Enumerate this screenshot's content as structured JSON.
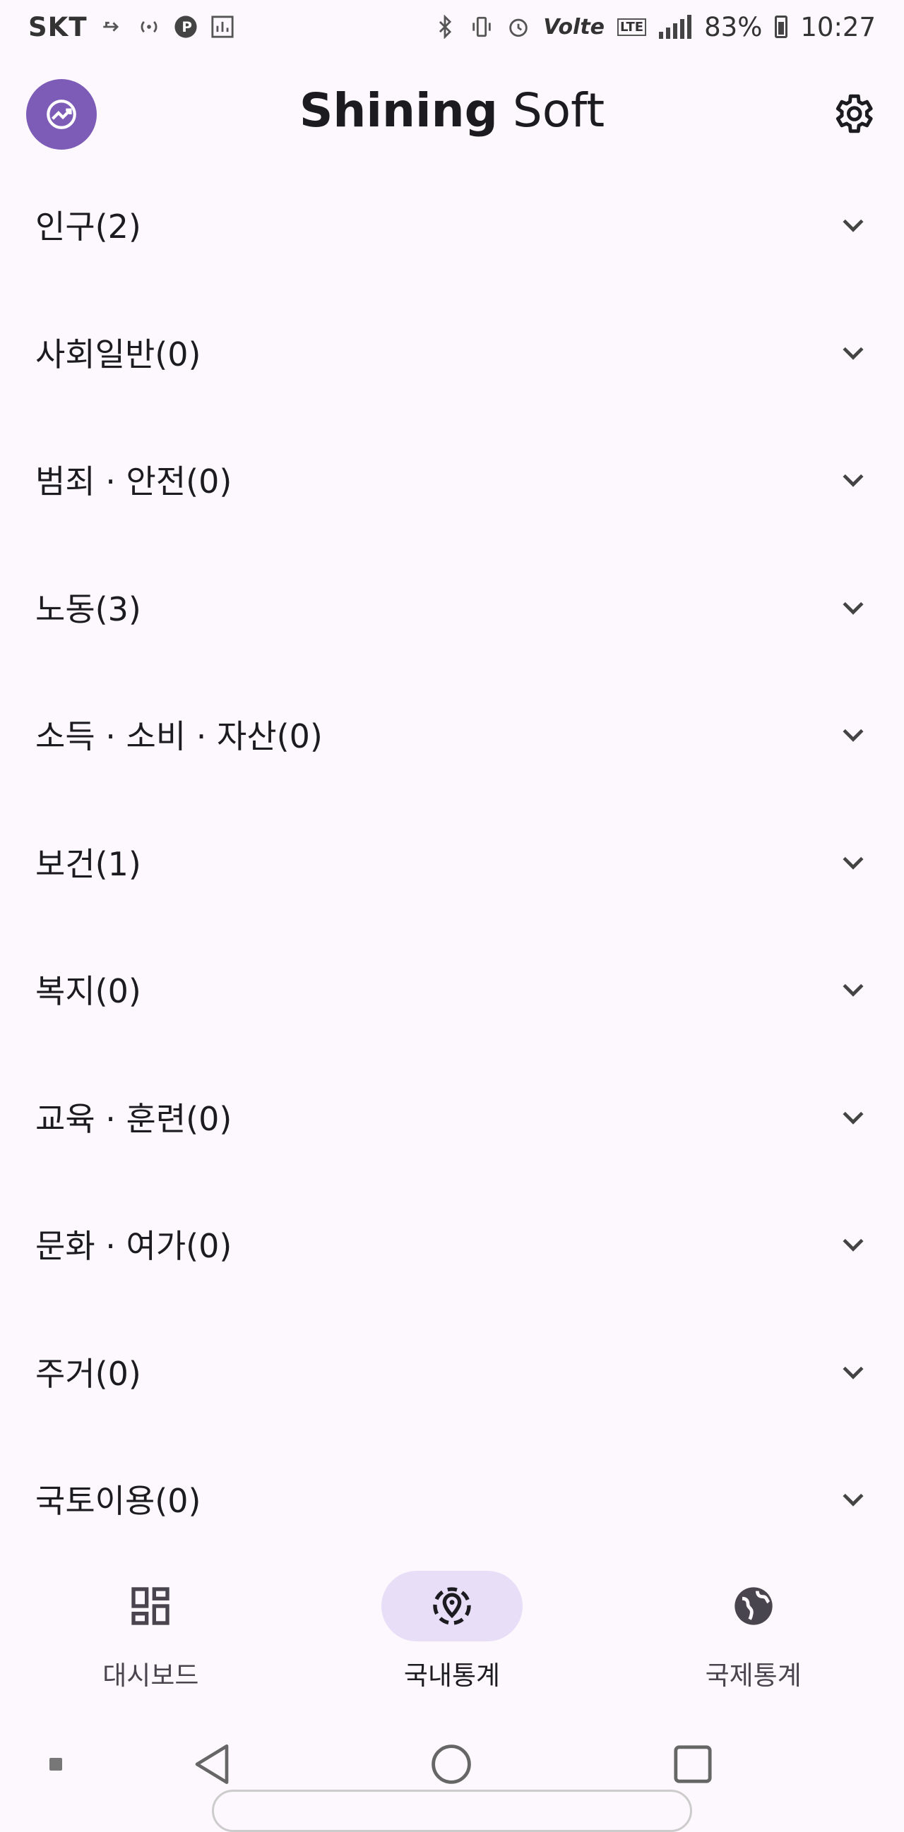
{
  "status": {
    "carrier": "SKT",
    "battery": "83%",
    "time": "10:27",
    "volte": "Volte",
    "lte": "LTE"
  },
  "header": {
    "title_bold": "Shining",
    "title_rest": " Soft",
    "logo_icon": "trending-chart-icon",
    "settings_icon": "gear-icon"
  },
  "categories": [
    {
      "label": "인구(2)"
    },
    {
      "label": "사회일반(0)"
    },
    {
      "label": "범죄 · 안전(0)"
    },
    {
      "label": "노동(3)"
    },
    {
      "label": "소득 · 소비 · 자산(0)"
    },
    {
      "label": "보건(1)"
    },
    {
      "label": "복지(0)"
    },
    {
      "label": "교육 · 훈련(0)"
    },
    {
      "label": "문화 · 여가(0)"
    },
    {
      "label": "주거(0)"
    },
    {
      "label": "국토이용(0)"
    }
  ],
  "bottom_nav": {
    "items": [
      {
        "label": "대시보드",
        "icon": "dashboard-icon"
      },
      {
        "label": "국내통계",
        "icon": "location-icon"
      },
      {
        "label": "국제통계",
        "icon": "globe-icon"
      }
    ],
    "active_index": 1
  },
  "colors": {
    "background": "#fdf8fd",
    "accent": "#7d5cb8",
    "active_pill": "#e8def8"
  }
}
